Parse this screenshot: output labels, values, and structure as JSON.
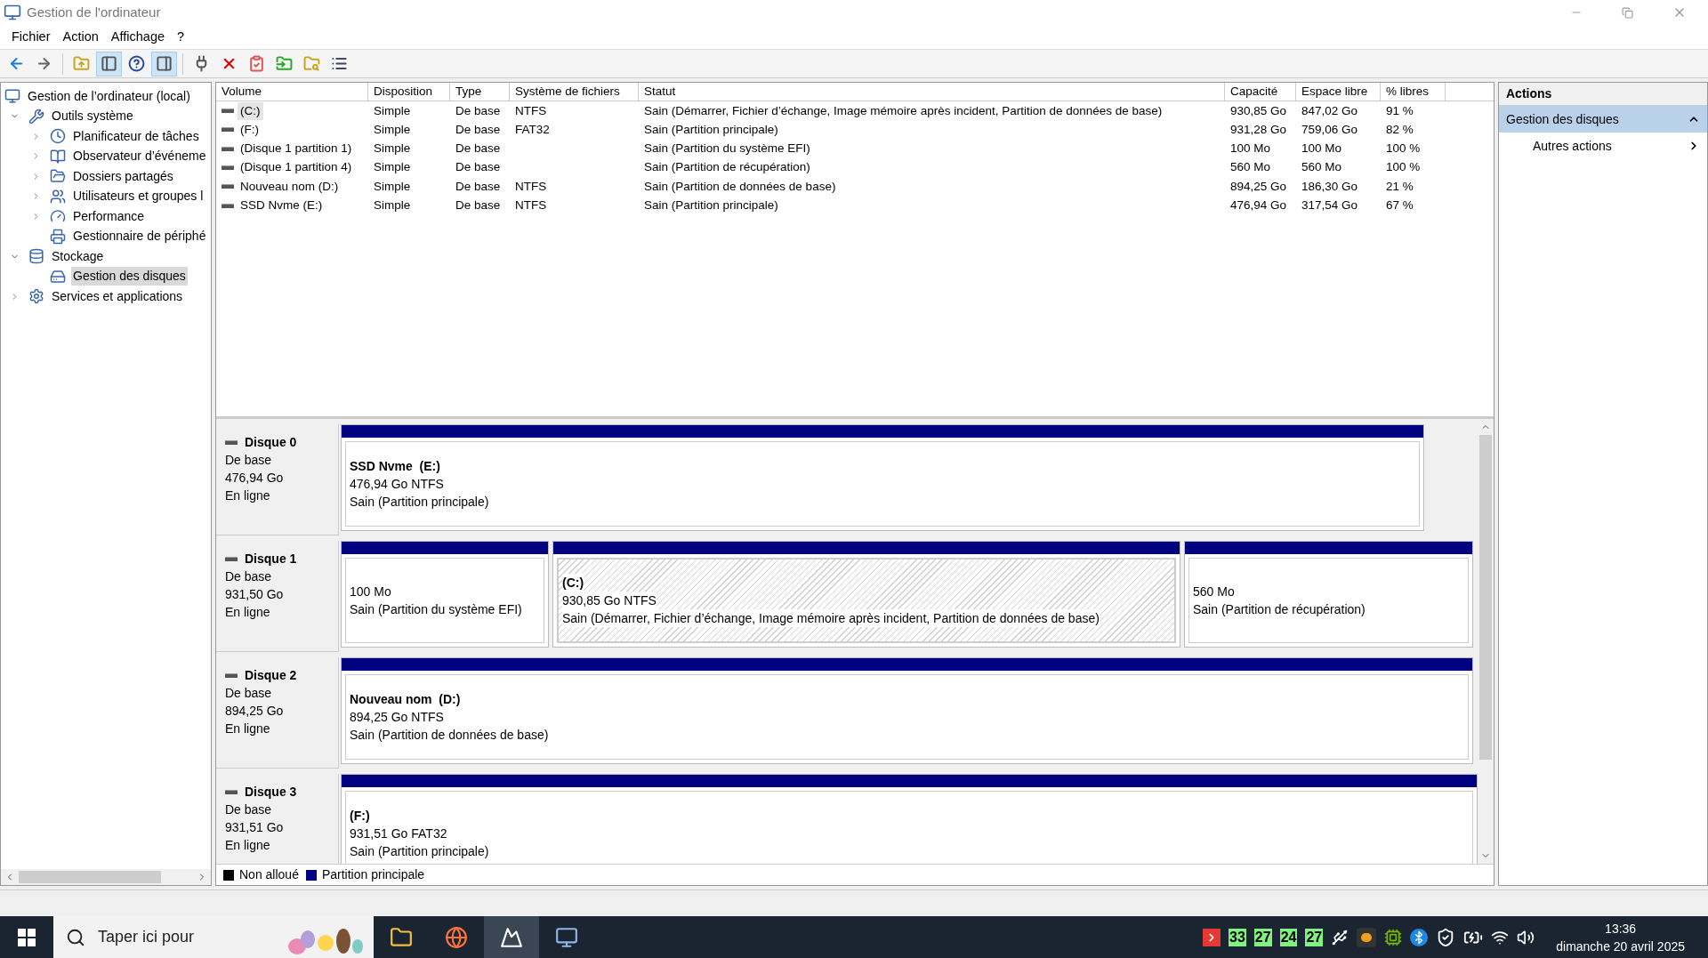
{
  "window": {
    "title": "Gestion de l'ordinateur"
  },
  "menu": [
    "Fichier",
    "Action",
    "Affichage",
    "?"
  ],
  "toolbar": [
    {
      "kind": "back",
      "pressed": false
    },
    {
      "kind": "forward",
      "pressed": false
    },
    {
      "kind": "up",
      "pressed": false
    },
    {
      "kind": "tree",
      "pressed": true
    },
    {
      "kind": "help",
      "pressed": false
    },
    {
      "kind": "pane",
      "pressed": true
    },
    {
      "kind": "connect",
      "pressed": false
    },
    {
      "kind": "delete",
      "pressed": false
    },
    {
      "kind": "properties",
      "pressed": false
    },
    {
      "kind": "import",
      "pressed": false
    },
    {
      "kind": "find",
      "pressed": false
    },
    {
      "kind": "list",
      "pressed": false
    }
  ],
  "tree": [
    {
      "label": "Gestion de l’ordinateur (local)",
      "kind": "computer",
      "selected": false,
      "children": [
        {
          "label": "Outils système",
          "kind": "tools",
          "selected": false,
          "expanded": true,
          "children": [
            {
              "label": "Planificateur de tâches",
              "kind": "clock",
              "selected": false,
              "expanded": false
            },
            {
              "label": "Observateur d’événeme",
              "kind": "log",
              "selected": false,
              "expanded": false
            },
            {
              "label": "Dossiers partagés",
              "kind": "folder",
              "selected": false,
              "expanded": false
            },
            {
              "label": "Utilisateurs et groupes l",
              "kind": "users",
              "selected": false,
              "expanded": false
            },
            {
              "label": "Performance",
              "kind": "perf",
              "selected": false,
              "expanded": false
            },
            {
              "label": "Gestionnaire de périphé",
              "kind": "device",
              "selected": false
            }
          ]
        },
        {
          "label": "Stockage",
          "kind": "storage",
          "selected": false,
          "expanded": true,
          "children": [
            {
              "label": "Gestion des disques",
              "kind": "disk",
              "selected": true
            }
          ]
        },
        {
          "label": "Services et applications",
          "kind": "services",
          "selected": false,
          "expanded": false
        }
      ]
    }
  ],
  "table": {
    "columns": [
      "Volume",
      "Disposition",
      "Type",
      "Système de fichiers",
      "Statut",
      "Capacité",
      "Espace libre",
      "% libres"
    ],
    "rows": [
      {
        "selected": true,
        "cells": [
          "(C:)",
          "Simple",
          "De base",
          "NTFS",
          "Sain (Démarrer, Fichier d’échange, Image mémoire après incident, Partition de données de base)",
          "930,85 Go",
          "847,02 Go",
          "91 %"
        ]
      },
      {
        "selected": false,
        "cells": [
          "(F:)",
          "Simple",
          "De base",
          "FAT32",
          "Sain (Partition principale)",
          "931,28 Go",
          "759,06 Go",
          "82 %"
        ]
      },
      {
        "selected": false,
        "cells": [
          "(Disque 1 partition 1)",
          "Simple",
          "De base",
          "",
          "Sain (Partition du système EFI)",
          "100 Mo",
          "100 Mo",
          "100 %"
        ]
      },
      {
        "selected": false,
        "cells": [
          "(Disque 1 partition 4)",
          "Simple",
          "De base",
          "",
          "Sain (Partition de récupération)",
          "560 Mo",
          "560 Mo",
          "100 %"
        ]
      },
      {
        "selected": false,
        "cells": [
          "Nouveau nom (D:)",
          "Simple",
          "De base",
          "NTFS",
          "Sain (Partition de données de base)",
          "894,25 Go",
          "186,30 Go",
          "21 %"
        ]
      },
      {
        "selected": false,
        "cells": [
          "SSD Nvme (E:)",
          "Simple",
          "De base",
          "NTFS",
          "Sain (Partition principale)",
          "476,94 Go",
          "317,54 Go",
          "67 %"
        ]
      }
    ]
  },
  "disks": [
    {
      "name": "Disque 0",
      "type": "De base",
      "size": "476,94 Go",
      "state": "En ligne",
      "partitions": [
        {
          "title": "SSD Nvme  (E:)",
          "size": "476,94 Go NTFS",
          "status": "Sain (Partition principale)",
          "selected": false
        }
      ]
    },
    {
      "name": "Disque 1",
      "type": "De base",
      "size": "931,50 Go",
      "state": "En ligne",
      "partitions": [
        {
          "size": "100 Mo",
          "status": "Sain (Partition du système EFI)",
          "selected": false
        },
        {
          "title": "(C:)",
          "size": "930,85 Go NTFS",
          "status": "Sain (Démarrer, Fichier d’échange, Image mémoire après incident, Partition de données de base)",
          "selected": true
        },
        {
          "size": "560 Mo",
          "status": "Sain (Partition de récupération)",
          "selected": false
        }
      ]
    },
    {
      "name": "Disque 2",
      "type": "De base",
      "size": "894,25 Go",
      "state": "En ligne",
      "partitions": [
        {
          "title": "Nouveau nom  (D:)",
          "size": "894,25 Go NTFS",
          "status": "Sain (Partition de données de base)",
          "selected": false
        }
      ]
    },
    {
      "name": "Disque 3",
      "type": "De base",
      "size": "931,51 Go",
      "state": "En ligne",
      "partitions": [
        {
          "title": "(F:)",
          "size": "931,51 Go FAT32",
          "status": "Sain (Partition principale)",
          "selected": false
        }
      ]
    }
  ],
  "legend": [
    {
      "label": "Non alloué",
      "color": "#000000"
    },
    {
      "label": "Partition principale",
      "color": "#000080"
    }
  ],
  "actions": {
    "title": "Actions",
    "section": {
      "label": "Gestion des disques",
      "expanded": true
    },
    "items": [
      "Autres actions"
    ]
  },
  "taskbar": {
    "search": {
      "placeholder": "Taper ici pour"
    },
    "apps": [
      {
        "kind": "explorer",
        "selected": false
      },
      {
        "kind": "firefox",
        "selected": false
      },
      {
        "kind": "app",
        "selected": true
      },
      {
        "kind": "computer",
        "selected": false
      }
    ],
    "temps": [
      "33",
      "27",
      "24",
      "27"
    ],
    "time": "13:36",
    "date": "dimanche 20 avril 2025"
  }
}
